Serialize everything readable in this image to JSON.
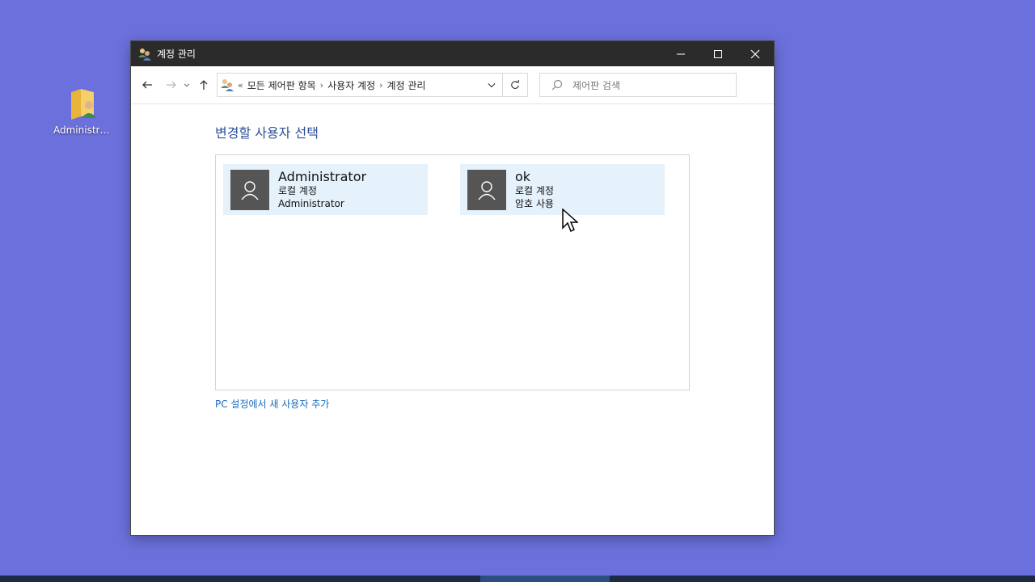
{
  "desktop": {
    "icon_label": "Administra..."
  },
  "window": {
    "title": "계정 관리",
    "minimize": "minimize",
    "maximize": "maximize",
    "close": "close"
  },
  "nav": {
    "overflow": "«",
    "breadcrumbs": [
      "모든 제어판 항목",
      "사용자 계정",
      "계정 관리"
    ],
    "separator": "›",
    "search_placeholder": "제어판 검색"
  },
  "main": {
    "heading": "변경할 사용자 선택",
    "accounts": [
      {
        "name": "Administrator",
        "type": "로컬 계정",
        "detail": "Administrator"
      },
      {
        "name": "ok",
        "type": "로컬 계정",
        "detail": "암호 사용"
      }
    ],
    "add_user_link": "PC 설정에서 새 사용자 추가"
  },
  "colors": {
    "desktop_bg": "#6b70dc",
    "titlebar_bg": "#2b2b2b",
    "tile_bg": "#e5f1fb",
    "link": "#1a6bbf",
    "heading": "#2a4f9a"
  }
}
